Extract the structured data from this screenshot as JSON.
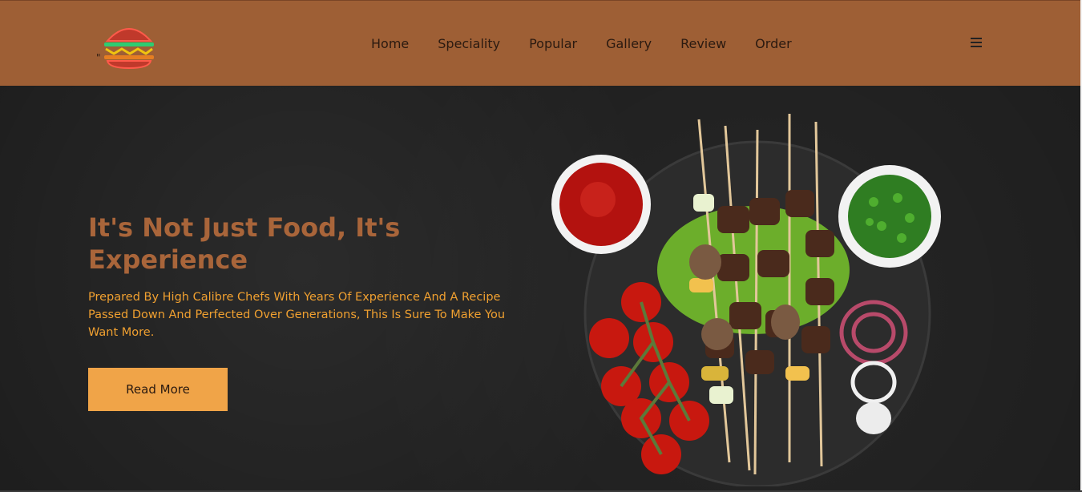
{
  "header": {
    "logo_icon": "neon-burger-icon",
    "logo_mark": "\"",
    "nav": [
      "Home",
      "Speciality",
      "Popular",
      "Gallery",
      "Review",
      "Order"
    ],
    "menu_icon": "hamburger-menu-icon",
    "background": "#9e5f35"
  },
  "hero": {
    "title": "It's Not Just Food, It's Experience",
    "description": "Prepared By High Calibre Chefs With Years Of Experience And A Recipe Passed Down And Perfected Over Generations, This Is Sure To Make You Want More.",
    "button_label": "Read More",
    "image": "grilled-kebab-skewers-platter",
    "title_color": "#a9653a",
    "text_color": "#f0a030",
    "button_color": "#f0a448"
  }
}
